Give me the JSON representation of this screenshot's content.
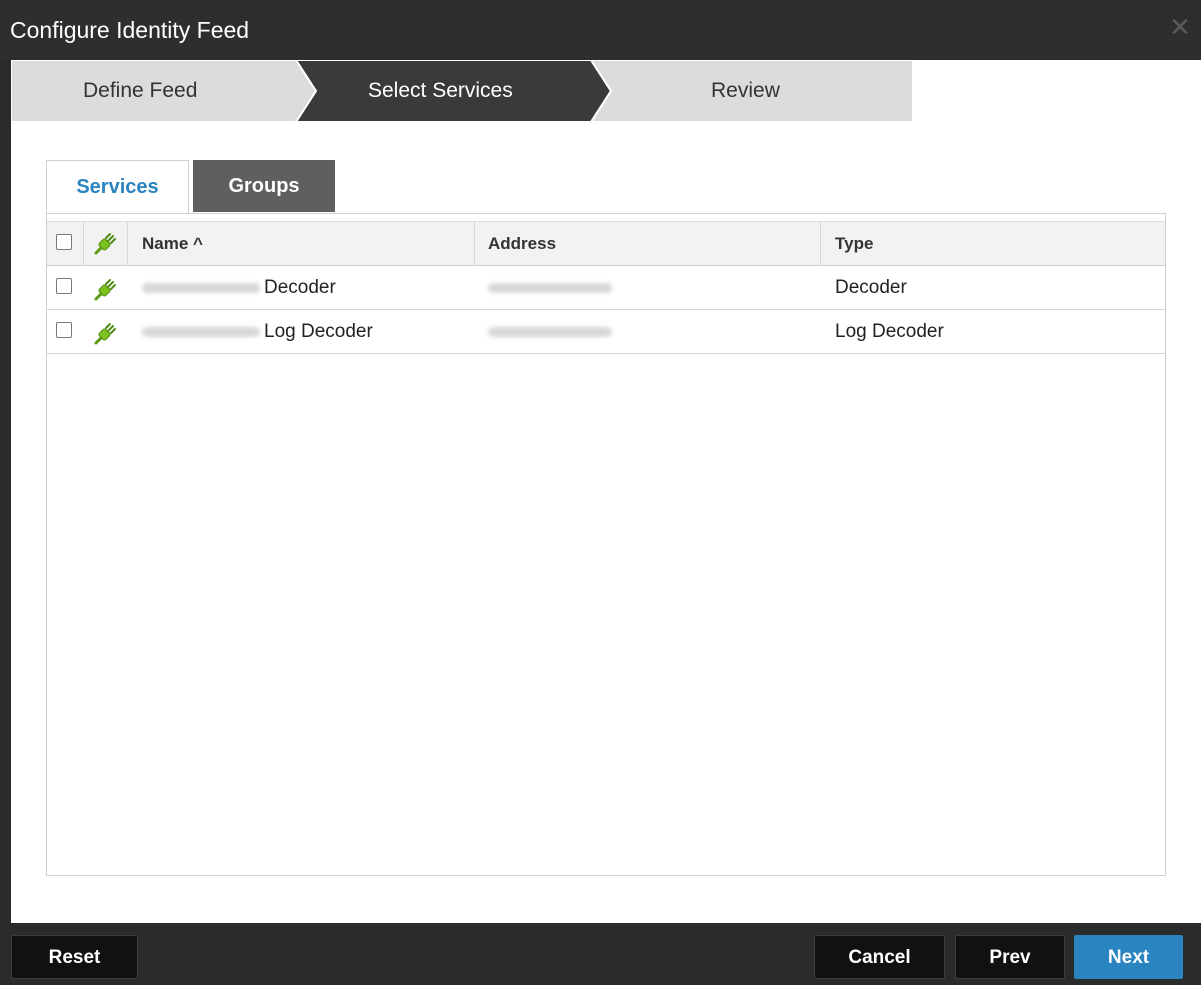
{
  "dialog": {
    "title": "Configure Identity Feed",
    "close_icon": "close-icon"
  },
  "wizard": {
    "steps": [
      {
        "label": "Define Feed",
        "state": "done"
      },
      {
        "label": "Select Services",
        "state": "active"
      },
      {
        "label": "Review",
        "state": "pending"
      }
    ]
  },
  "tabs": [
    {
      "label": "Services",
      "selected": true
    },
    {
      "label": "Groups",
      "selected": false
    }
  ],
  "grid": {
    "columns": [
      {
        "label": "",
        "kind": "checkbox"
      },
      {
        "label": "",
        "kind": "status-icon",
        "icon": "plug-icon"
      },
      {
        "label": "Name ^",
        "sorted": "ascending"
      },
      {
        "label": "Address"
      },
      {
        "label": "Type"
      }
    ],
    "rows": [
      {
        "name": "Decoder",
        "type": "Decoder",
        "checked": false,
        "status": "connected"
      },
      {
        "name": "Log Decoder",
        "type": "Log Decoder",
        "checked": false,
        "status": "connected"
      }
    ]
  },
  "footer": {
    "reset": "Reset",
    "cancel": "Cancel",
    "prev": "Prev",
    "next": "Next"
  },
  "colors": {
    "accent": "#2a84c0",
    "plug": "#7cc21f",
    "dark": "#2b2b2b"
  }
}
